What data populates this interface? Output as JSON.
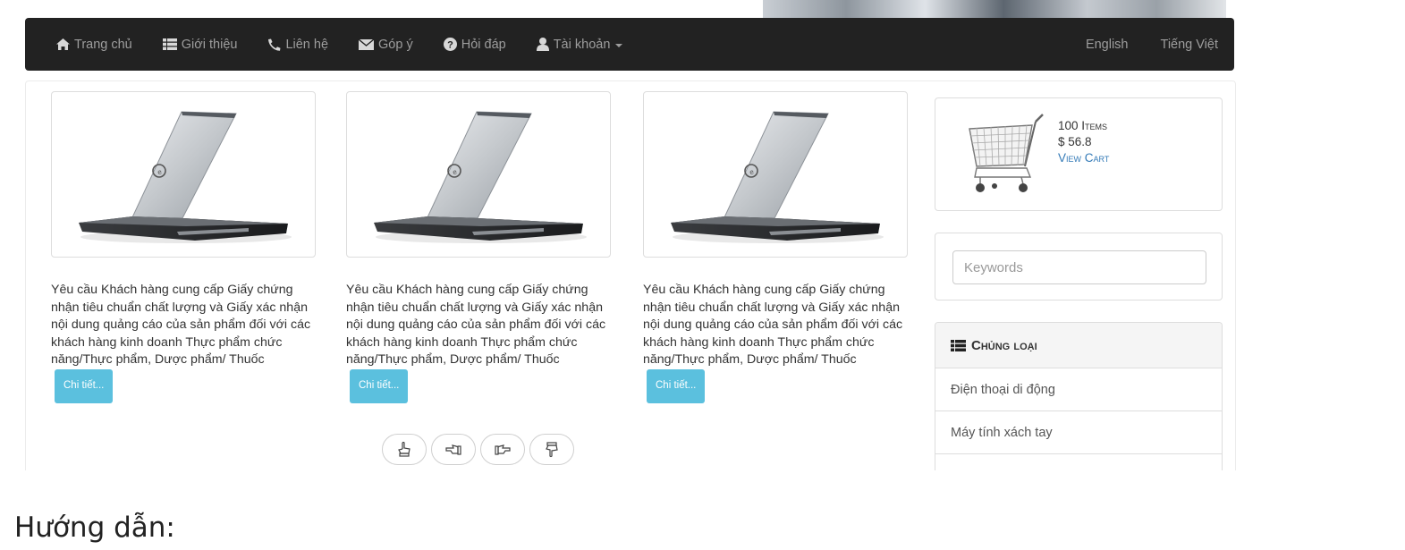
{
  "nav": {
    "items": [
      {
        "label": "Trang chủ",
        "icon": "home-icon"
      },
      {
        "label": "Giới thiệu",
        "icon": "list-icon"
      },
      {
        "label": "Liên hệ",
        "icon": "phone-icon"
      },
      {
        "label": "Góp ý",
        "icon": "envelope-icon"
      },
      {
        "label": "Hỏi đáp",
        "icon": "question-circle-icon"
      },
      {
        "label": "Tài khoản",
        "icon": "user-icon"
      }
    ],
    "lang_en": "English",
    "lang_vi": "Tiếng Việt"
  },
  "products": [
    {
      "text": "Yêu cầu Khách hàng cung cấp Giấy chứng nhận tiêu chuẩn chất lượng và Giấy xác nhận nội dung quảng cáo của sản phẩm đối với các khách hàng kinh doanh Thực phẩm chức năng/Thực phẩm, Dược phẩm/ Thuốc",
      "button": "Chi tiết..."
    },
    {
      "text": "Yêu cầu Khách hàng cung cấp Giấy chứng nhận tiêu chuẩn chất lượng và Giấy xác nhận nội dung quảng cáo của sản phẩm đối với các khách hàng kinh doanh Thực phẩm chức năng/Thực phẩm, Dược phẩm/ Thuốc",
      "button": "Chi tiết..."
    },
    {
      "text": "Yêu cầu Khách hàng cung cấp Giấy chứng nhận tiêu chuẩn chất lượng và Giấy xác nhận nội dung quảng cáo của sản phẩm đối với các khách hàng kinh doanh Thực phẩm chức năng/Thực phẩm, Dược phẩm/ Thuốc",
      "button": "Chi tiết..."
    }
  ],
  "pager": [
    "hand-up-icon",
    "hand-left-icon",
    "hand-right-icon",
    "hand-down-icon"
  ],
  "cart": {
    "count": "100",
    "items_label": "Items",
    "total": "$ 56.8",
    "view_cart": "View Cart"
  },
  "search": {
    "placeholder": "Keywords"
  },
  "categories": {
    "title": "Chủng loại",
    "items": [
      "Điện thoại di động",
      "Máy tính xách tay"
    ]
  },
  "footer": {
    "label": "Hướng dẫn:"
  },
  "colors": {
    "navbar": "#222222",
    "accent": "#5bc0de",
    "link": "#337ab7"
  }
}
